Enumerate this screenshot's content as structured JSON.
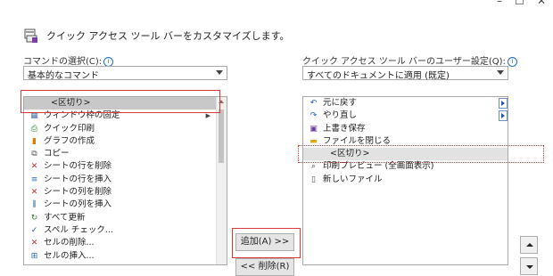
{
  "window": {
    "minimize": "–",
    "restore": "☐",
    "close": "✕"
  },
  "header": {
    "title": "クイック アクセス ツール バーをカスタマイズします。",
    "icon": "customize-toolbar-icon"
  },
  "left": {
    "label": "コマンドの選択(C):",
    "info": "i",
    "dropdown_value": "基本的なコマンド",
    "items": [
      {
        "label": "<区切り>",
        "icon": "",
        "separator": true,
        "submenu": false
      },
      {
        "label": "ウィンドウ枠の固定",
        "icon": "freeze-panes-icon",
        "glyph": "▦",
        "color": "#4a6fa5",
        "submenu": true
      },
      {
        "label": "クイック印刷",
        "icon": "quick-print-icon",
        "glyph": "⎙",
        "color": "#2e7d32",
        "submenu": false
      },
      {
        "label": "グラフの作成",
        "icon": "chart-icon",
        "glyph": "▮",
        "color": "#e07b00",
        "submenu": false
      },
      {
        "label": "コピー",
        "icon": "copy-icon",
        "glyph": "⧉",
        "color": "#555555",
        "submenu": false
      },
      {
        "label": "シートの行を削除",
        "icon": "delete-row-icon",
        "glyph": "✕",
        "color": "#c62828",
        "submenu": false
      },
      {
        "label": "シートの行を挿入",
        "icon": "insert-row-icon",
        "glyph": "≡",
        "color": "#2e6db0",
        "submenu": false
      },
      {
        "label": "シートの列を削除",
        "icon": "delete-column-icon",
        "glyph": "✕",
        "color": "#c62828",
        "submenu": false
      },
      {
        "label": "シートの列を挿入",
        "icon": "insert-column-icon",
        "glyph": "⫼",
        "color": "#2e6db0",
        "submenu": false
      },
      {
        "label": "すべて更新",
        "icon": "refresh-all-icon",
        "glyph": "↻",
        "color": "#2e7d32",
        "submenu": false
      },
      {
        "label": "スペル チェック...",
        "icon": "spell-check-icon",
        "glyph": "✓",
        "color": "#1e5bb8",
        "submenu": false
      },
      {
        "label": "セルの削除...",
        "icon": "delete-cells-icon",
        "glyph": "✕",
        "color": "#c62828",
        "submenu": false
      },
      {
        "label": "セルの挿入...",
        "icon": "insert-cells-icon",
        "glyph": "⊞",
        "color": "#2e6db0",
        "submenu": false
      }
    ]
  },
  "middle": {
    "add_label": "追加(A) >>",
    "remove_label": "<< 削除(R)"
  },
  "right": {
    "label": "クイック アクセス ツール バーのユーザー設定(Q):",
    "info": "i",
    "dropdown_value": "すべてのドキュメントに適用 (既定)",
    "items": [
      {
        "label": "元に戻す",
        "icon": "undo-icon",
        "glyph": "↶",
        "color": "#1e5bb8",
        "separator": false,
        "submenu": true
      },
      {
        "label": "やり直し",
        "icon": "redo-icon",
        "glyph": "↷",
        "color": "#1e5bb8",
        "separator": false,
        "submenu": true
      },
      {
        "label": "上書き保存",
        "icon": "save-icon",
        "glyph": "▣",
        "color": "#6a3fa0",
        "separator": false,
        "submenu": false
      },
      {
        "label": "ファイルを閉じる",
        "icon": "close-file-icon",
        "glyph": "▬",
        "color": "#e0a800",
        "separator": false,
        "submenu": false
      },
      {
        "label": "<区切り>",
        "icon": "",
        "glyph": "",
        "color": "",
        "separator": true,
        "submenu": false
      },
      {
        "label": "印刷プレビュー (全画面表示)",
        "icon": "print-preview-icon",
        "glyph": "⌕",
        "color": "#444444",
        "separator": false,
        "submenu": false
      },
      {
        "label": "新しいファイル",
        "icon": "new-file-icon",
        "glyph": "▯",
        "color": "#555555",
        "separator": false,
        "submenu": false
      }
    ]
  }
}
